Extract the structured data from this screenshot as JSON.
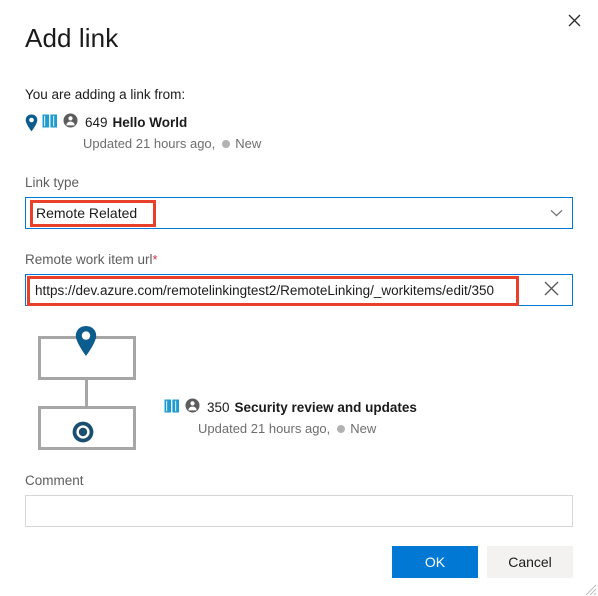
{
  "dialog": {
    "title": "Add link",
    "close_icon": "close-icon"
  },
  "source": {
    "intro_label": "You are adding a link from:",
    "pin_icon": "location-pin-icon",
    "type_icon": "epic-book-icon",
    "avatar_icon": "user-avatar-icon",
    "id": "649",
    "title": "Hello World",
    "updated": "Updated 21 hours ago,",
    "state": "New"
  },
  "link_type": {
    "label": "Link type",
    "value": "Remote Related",
    "chevron_icon": "chevron-down-icon"
  },
  "remote_url": {
    "label": "Remote work item url",
    "required_marker": "*",
    "value": "https://dev.azure.com/remotelinkingtest2/RemoteLinking/_workitems/edit/350",
    "placeholder": "",
    "clear_icon": "clear-x-icon"
  },
  "preview": {
    "source_node_icon": "location-pin-icon",
    "target_node_icon": "target-bullseye-icon",
    "target": {
      "type_icon": "epic-book-icon",
      "avatar_icon": "user-avatar-icon",
      "id": "350",
      "title": "Security review and updates",
      "updated": "Updated 21 hours ago,",
      "state": "New"
    }
  },
  "comment": {
    "label": "Comment",
    "value": "",
    "placeholder": ""
  },
  "footer": {
    "ok_label": "OK",
    "cancel_label": "Cancel"
  },
  "colors": {
    "accent": "#0078d4",
    "annotation": "#e8402a",
    "node_border": "#a6a6a6",
    "state_dot": "#b2b2b2",
    "required": "#c4314b"
  }
}
